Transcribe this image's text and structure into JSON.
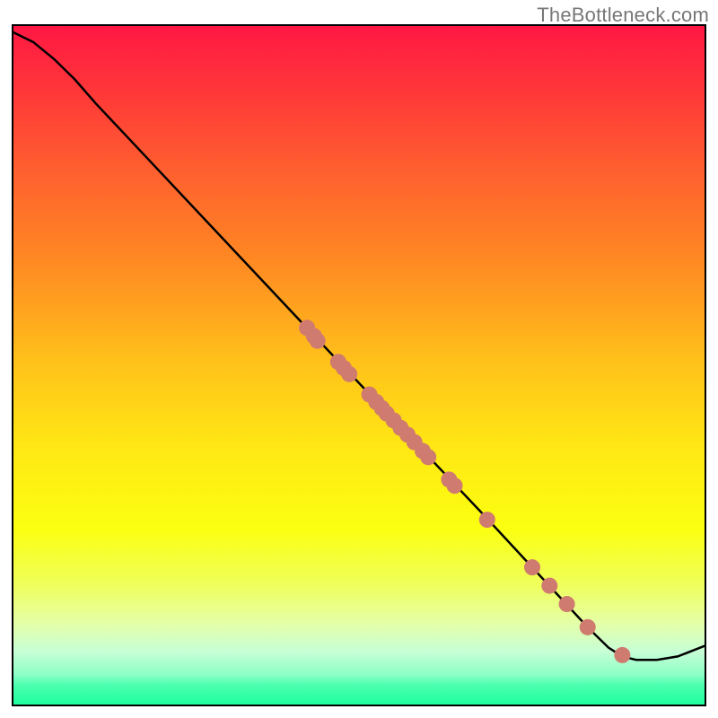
{
  "watermark": "TheBottleneck.com",
  "chart_data": {
    "type": "line",
    "title": "",
    "xlabel": "",
    "ylabel": "",
    "xlim": [
      0,
      100
    ],
    "ylim": [
      0,
      100
    ],
    "background_gradient_stops": [
      {
        "offset": 0.0,
        "color": "#ff1744"
      },
      {
        "offset": 0.1,
        "color": "#ff3838"
      },
      {
        "offset": 0.22,
        "color": "#ff612f"
      },
      {
        "offset": 0.35,
        "color": "#ff8a22"
      },
      {
        "offset": 0.5,
        "color": "#ffc31a"
      },
      {
        "offset": 0.62,
        "color": "#ffe714"
      },
      {
        "offset": 0.74,
        "color": "#fbff10"
      },
      {
        "offset": 0.82,
        "color": "#f0ff59"
      },
      {
        "offset": 0.88,
        "color": "#e4ffa8"
      },
      {
        "offset": 0.92,
        "color": "#c8ffd6"
      },
      {
        "offset": 0.955,
        "color": "#8bffc6"
      },
      {
        "offset": 0.97,
        "color": "#4cffb0"
      },
      {
        "offset": 1.0,
        "color": "#1cff9e"
      }
    ],
    "curve_points": [
      {
        "x": 0.0,
        "y": 99.0
      },
      {
        "x": 3.0,
        "y": 97.5
      },
      {
        "x": 6.0,
        "y": 95.0
      },
      {
        "x": 9.0,
        "y": 92.0
      },
      {
        "x": 12.0,
        "y": 88.5
      },
      {
        "x": 18.0,
        "y": 82.0
      },
      {
        "x": 30.0,
        "y": 69.0
      },
      {
        "x": 42.0,
        "y": 56.0
      },
      {
        "x": 55.0,
        "y": 42.0
      },
      {
        "x": 68.0,
        "y": 28.0
      },
      {
        "x": 78.0,
        "y": 17.0
      },
      {
        "x": 83.0,
        "y": 11.5
      },
      {
        "x": 86.0,
        "y": 8.5
      },
      {
        "x": 88.0,
        "y": 7.2
      },
      {
        "x": 90.0,
        "y": 6.7
      },
      {
        "x": 93.0,
        "y": 6.7
      },
      {
        "x": 96.0,
        "y": 7.2
      },
      {
        "x": 100.0,
        "y": 8.8
      }
    ],
    "scatter_points": [
      {
        "x": 42.5,
        "y": 55.5
      },
      {
        "x": 43.5,
        "y": 54.3
      },
      {
        "x": 44.0,
        "y": 53.6
      },
      {
        "x": 47.0,
        "y": 50.5
      },
      {
        "x": 47.8,
        "y": 49.6
      },
      {
        "x": 48.6,
        "y": 48.7
      },
      {
        "x": 51.5,
        "y": 45.7
      },
      {
        "x": 52.5,
        "y": 44.6
      },
      {
        "x": 53.3,
        "y": 43.7
      },
      {
        "x": 54.0,
        "y": 42.9
      },
      {
        "x": 55.0,
        "y": 41.9
      },
      {
        "x": 56.0,
        "y": 40.8
      },
      {
        "x": 57.0,
        "y": 39.8
      },
      {
        "x": 58.0,
        "y": 38.7
      },
      {
        "x": 59.2,
        "y": 37.4
      },
      {
        "x": 60.0,
        "y": 36.5
      },
      {
        "x": 63.0,
        "y": 33.2
      },
      {
        "x": 63.8,
        "y": 32.3
      },
      {
        "x": 68.5,
        "y": 27.3
      },
      {
        "x": 75.0,
        "y": 20.3
      },
      {
        "x": 77.5,
        "y": 17.6
      },
      {
        "x": 80.0,
        "y": 14.9
      },
      {
        "x": 83.0,
        "y": 11.5
      },
      {
        "x": 88.0,
        "y": 7.4
      }
    ],
    "scatter_color": "#cf7b6f",
    "curve_color": "#000000",
    "scatter_radius": 9
  }
}
